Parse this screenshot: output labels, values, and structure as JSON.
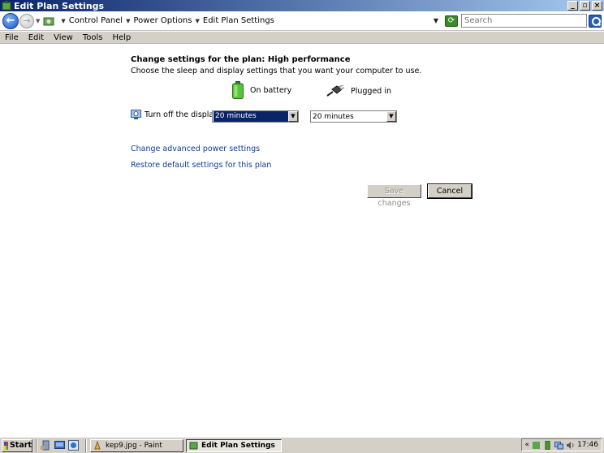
{
  "window": {
    "title": "Edit Plan Settings"
  },
  "titlebar_buttons": {
    "minimize": "_",
    "restore": "▫",
    "close": "×"
  },
  "address": {
    "back_glyph": "←",
    "forward_glyph": "→",
    "crumbs": [
      "Control Panel",
      "Power Options",
      "Edit Plan Settings"
    ],
    "search_placeholder": "Search"
  },
  "menu": [
    "File",
    "Edit",
    "View",
    "Tools",
    "Help"
  ],
  "main": {
    "heading": "Change settings for the plan: High performance",
    "subtext": "Choose the sleep and display settings that you want your computer to use.",
    "on_battery_label": "On battery",
    "plugged_in_label": "Plugged in",
    "display_label": "Turn off the display:",
    "display_on_battery": "20 minutes",
    "display_plugged_in": "20 minutes",
    "advanced_link": "Change advanced power settings",
    "restore_link": "Restore default settings for this plan",
    "save_button": "Save changes",
    "cancel_button": "Cancel"
  },
  "taskbar": {
    "start_label": "Start",
    "tasks": [
      "kep9.jpg - Paint",
      "Edit Plan Settings"
    ],
    "tray_chevron": "«",
    "clock": "17:46"
  },
  "colors": {
    "title_gradient_start": "#0a246a",
    "chrome": "#d4d0c8",
    "link": "#0b3c9c",
    "selection": "#0a246a"
  }
}
